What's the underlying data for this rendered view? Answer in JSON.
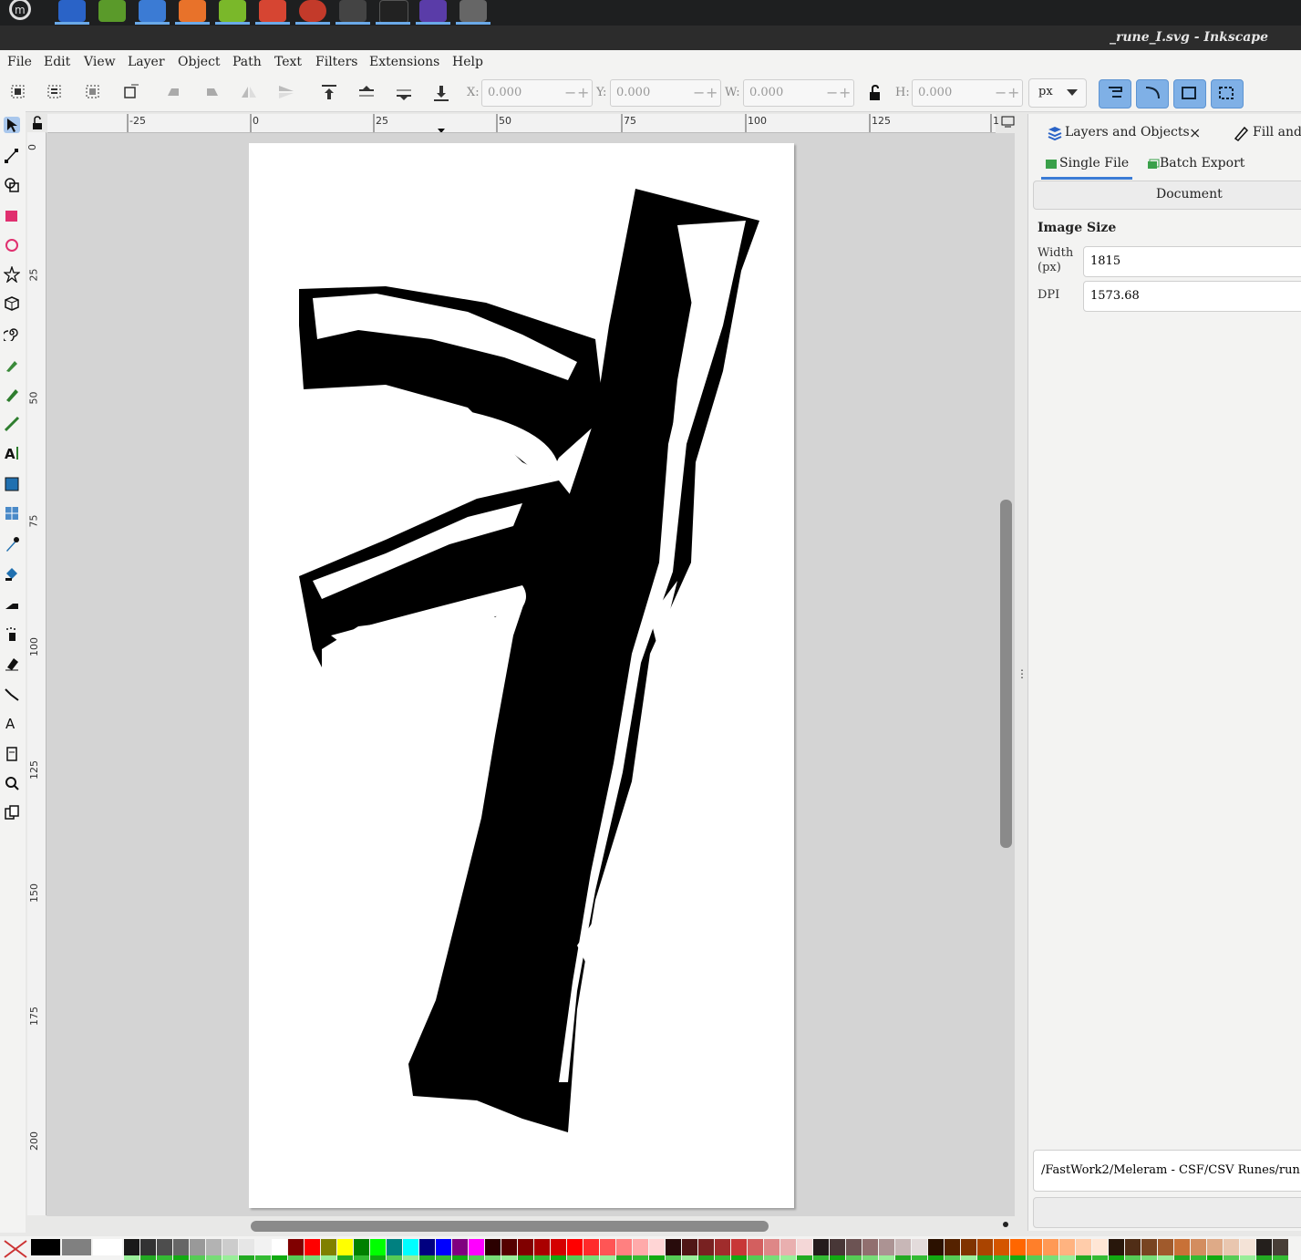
{
  "window": {
    "title": "_rune_I.svg - Inkscape"
  },
  "menu": [
    "File",
    "Edit",
    "View",
    "Layer",
    "Object",
    "Path",
    "Text",
    "Filters",
    "Extensions",
    "Help"
  ],
  "toolbar": {
    "x_label": "X:",
    "x_value": "0.000",
    "y_label": "Y:",
    "y_value": "0.000",
    "w_label": "W:",
    "w_value": "0.000",
    "h_label": "H:",
    "h_value": "0.000",
    "unit": "px"
  },
  "ruler": {
    "h_labels": [
      "-25",
      "0",
      "25",
      "50",
      "75",
      "100",
      "125",
      "1"
    ],
    "v_labels": [
      "0",
      "25",
      "50",
      "75",
      "100",
      "125",
      "150",
      "175",
      "200"
    ]
  },
  "panel": {
    "tab_layers": "Layers and Objects",
    "tab_fill": "Fill and",
    "tab_close": "×",
    "export_single": "Single File",
    "export_batch": "Batch Export",
    "document_btn": "Document",
    "image_size_heading": "Image Size",
    "width_label": "Width\n(px)",
    "width_value": "1815",
    "dpi_label": "DPI",
    "dpi_value": "1573.68",
    "path_value": "/FastWork2/Meleram - CSF/CSV Runes/run"
  },
  "colors": {
    "accent": "#7fb0e6",
    "taskbar": "#1e1f20"
  }
}
